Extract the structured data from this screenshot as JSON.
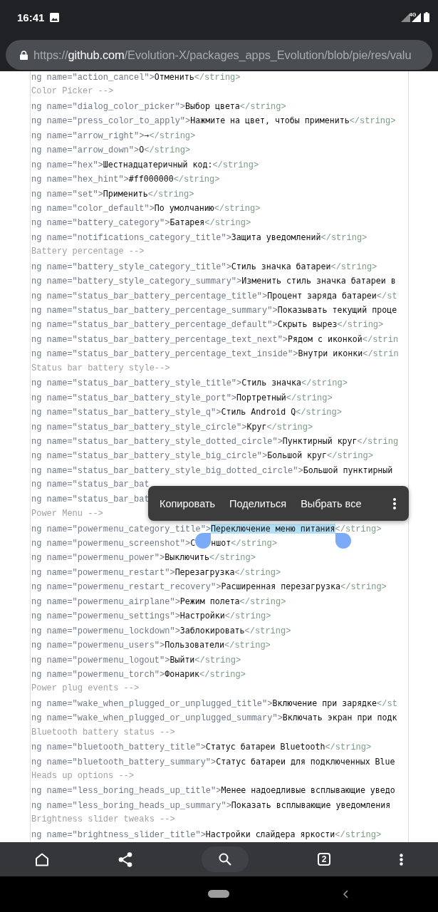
{
  "status_bar": {
    "time": "16:41",
    "network_type": "4G"
  },
  "url_bar": {
    "scheme": "https://",
    "host": "github.com",
    "path": "/Evolution-X/packages_apps_Evolution/blob/pie/res/valu"
  },
  "lines": [
    {
      "kind": "string",
      "open": "ng name=\"action_cancel\">",
      "value": "Отменить",
      "close": "</string>",
      "selected": false
    },
    {
      "kind": "comment",
      "text": "Color Picker -->"
    },
    {
      "kind": "string",
      "open": "ng name=\"dialog_color_picker\">",
      "value": "Выбор цвета",
      "close": "</string>",
      "selected": false
    },
    {
      "kind": "string",
      "open": "ng name=\"press_color_to_apply\">",
      "value": "Нажмите на цвет, чтобы применить",
      "close": "</string>",
      "selected": false
    },
    {
      "kind": "string",
      "open": "ng name=\"arrow_right\">",
      "value": "→",
      "close": "</string>",
      "selected": false
    },
    {
      "kind": "string",
      "open": "ng name=\"arrow_down\">",
      "value": "O",
      "close": "</string>",
      "selected": false
    },
    {
      "kind": "string",
      "open": "ng name=\"hex\">",
      "value": "Шестнадцатеричный код:",
      "close": "</string>",
      "selected": false
    },
    {
      "kind": "string",
      "open": "ng name=\"hex_hint\">",
      "value": "#ff000000",
      "close": "</string>",
      "selected": false
    },
    {
      "kind": "string",
      "open": "ng name=\"set\">",
      "value": "Применить",
      "close": "</string>",
      "selected": false
    },
    {
      "kind": "string",
      "open": "ng name=\"color_default\">",
      "value": "По умолчанию",
      "close": "</string>",
      "selected": false
    },
    {
      "kind": "string",
      "open": "ng name=\"battery_category\">",
      "value": "Батарея",
      "close": "</string>",
      "selected": false
    },
    {
      "kind": "string",
      "open": "ng name=\"notifications_category_title\">",
      "value": "Защита уведомлений",
      "close": "</string>",
      "selected": false
    },
    {
      "kind": "comment",
      "text": "Battery percentage -->"
    },
    {
      "kind": "string",
      "open": "ng name=\"battery_style_category_title\">",
      "value": "Стиль значка батареи",
      "close": "</string>",
      "selected": false
    },
    {
      "kind": "string",
      "open": "ng name=\"battery_style_category_summary\">",
      "value": "Изменить стиль значка батареи в",
      "selected": false
    },
    {
      "kind": "string",
      "open": "ng name=\"status_bar_battery_percentage_title\">",
      "value": "Процент заряда батареи",
      "close": "</st",
      "selected": false
    },
    {
      "kind": "string",
      "open": "ng name=\"status_bar_battery_percentage_summary\">",
      "value": "Показывать текущий проце",
      "selected": false
    },
    {
      "kind": "string",
      "open": "ng name=\"status_bar_battery_percentage_default\">",
      "value": "Скрыть вырез",
      "close": "</string>",
      "selected": false
    },
    {
      "kind": "string",
      "open": "ng name=\"status_bar_battery_percentage_text_next\">",
      "value": "Рядом с иконкой",
      "close": "</strin",
      "selected": false
    },
    {
      "kind": "string",
      "open": "ng name=\"status_bar_battery_percentage_text_inside\">",
      "value": "Внутри иконки",
      "close": "</strin",
      "selected": false
    },
    {
      "kind": "comment",
      "text": "Status bar battery style-->"
    },
    {
      "kind": "string",
      "open": "ng name=\"status_bar_battery_style_title\">",
      "value": "Стиль значка",
      "close": "</string>",
      "selected": false
    },
    {
      "kind": "string",
      "open": "ng name=\"status_bar_battery_style_port\">",
      "value": "Портретный",
      "close": "</string>",
      "selected": false
    },
    {
      "kind": "string",
      "open": "ng name=\"status_bar_battery_style_q\">",
      "value": "Стиль Android Q",
      "close": "</string>",
      "selected": false
    },
    {
      "kind": "string",
      "open": "ng name=\"status_bar_battery_style_circle\">",
      "value": "Круг",
      "close": "</string>",
      "selected": false
    },
    {
      "kind": "string",
      "open": "ng name=\"status_bar_battery_style_dotted_circle\">",
      "value": "Пунктирный круг",
      "close": "</string",
      "selected": false
    },
    {
      "kind": "string",
      "open": "ng name=\"status_bar_battery_style_big_circle\">",
      "value": "Большой круг",
      "close": "</string>",
      "selected": false
    },
    {
      "kind": "string",
      "open": "ng name=\"status_bar_battery_style_big_dotted_circle\">",
      "value": "Большой пунктирный",
      "selected": false
    },
    {
      "kind": "string",
      "open": "ng name=\"status_bar_bat",
      "selected": false
    },
    {
      "kind": "string",
      "open": "ng name=\"status_bar_bat",
      "selected": false
    },
    {
      "kind": "comment",
      "text": "Power Menu -->"
    },
    {
      "kind": "string",
      "open": "ng name=\"powermenu_category_title\">",
      "value": "Переключение меню питания",
      "close": "</string>",
      "selected": true
    },
    {
      "kind": "string",
      "open": "ng name=\"powermenu_screenshot\">",
      "value": "С",
      "value_after_handle": "ншот",
      "close": "</string>",
      "selected": false
    },
    {
      "kind": "string",
      "open": "ng name=\"powermenu_power\">",
      "value": "Выключить",
      "close": "</string>",
      "selected": false
    },
    {
      "kind": "string",
      "open": "ng name=\"powermenu_restart\">",
      "value": "Перезагрузка",
      "close": "</string>",
      "selected": false
    },
    {
      "kind": "string",
      "open": "ng name=\"powermenu_restart_recovery\">",
      "value": "Расширенная перезагрузка",
      "close": "</string>",
      "selected": false
    },
    {
      "kind": "string",
      "open": "ng name=\"powermenu_airplane\">",
      "value": "Режим полета",
      "close": "</string>",
      "selected": false
    },
    {
      "kind": "string",
      "open": "ng name=\"powermenu_settings\">",
      "value": "Настройки",
      "close": "</string>",
      "selected": false
    },
    {
      "kind": "string",
      "open": "ng name=\"powermenu_lockdown\">",
      "value": "Заблокировать",
      "close": "</string>",
      "selected": false
    },
    {
      "kind": "string",
      "open": "ng name=\"powermenu_users\">",
      "value": "Пользователи",
      "close": "</string>",
      "selected": false
    },
    {
      "kind": "string",
      "open": "ng name=\"powermenu_logout\">",
      "value": "Выйти",
      "close": "</string>",
      "selected": false
    },
    {
      "kind": "string",
      "open": "ng name=\"powermenu_torch\">",
      "value": "Фонарик",
      "close": "</string>",
      "selected": false
    },
    {
      "kind": "comment",
      "text": "Power plug events -->"
    },
    {
      "kind": "string",
      "open": "ng name=\"wake_when_plugged_or_unplugged_title\">",
      "value": "Включение при зарядке",
      "close": "</st",
      "selected": false
    },
    {
      "kind": "string",
      "open": "ng name=\"wake_when_plugged_or_unplugged_summary\">",
      "value": "Включать экран при подк",
      "selected": false
    },
    {
      "kind": "comment",
      "text": "Bluetooth battery status -->"
    },
    {
      "kind": "string",
      "open": "ng name=\"bluetooth_battery_title\">",
      "value": "Статус батареи Bluetooth",
      "close": "</string>",
      "selected": false
    },
    {
      "kind": "string",
      "open": "ng name=\"bluetooth_battery_summary\">",
      "value": "Статус батареи для подключенных Blue",
      "selected": false
    },
    {
      "kind": "comment",
      "text": "Heads up options -->"
    },
    {
      "kind": "string",
      "open": "ng name=\"less_boring_heads_up_title\">",
      "value": "Менее надоедливые всплывающие уведо",
      "selected": false
    },
    {
      "kind": "string",
      "open": "ng name=\"less_boring_heads_up_summary\">",
      "value": "Показать всплывающие уведомления",
      "selected": false
    },
    {
      "kind": "comment",
      "text": "Brightness slider tweaks -->"
    },
    {
      "kind": "string",
      "open": "ng name=\"brightness_slider_title\">",
      "value": "Настройки слайдера яркости",
      "close": "</string>",
      "selected": false
    }
  ],
  "context_menu": {
    "items": [
      "Копировать",
      "Поделиться",
      "Выбрать все"
    ]
  },
  "toolbar": {
    "tab_count": "2"
  }
}
